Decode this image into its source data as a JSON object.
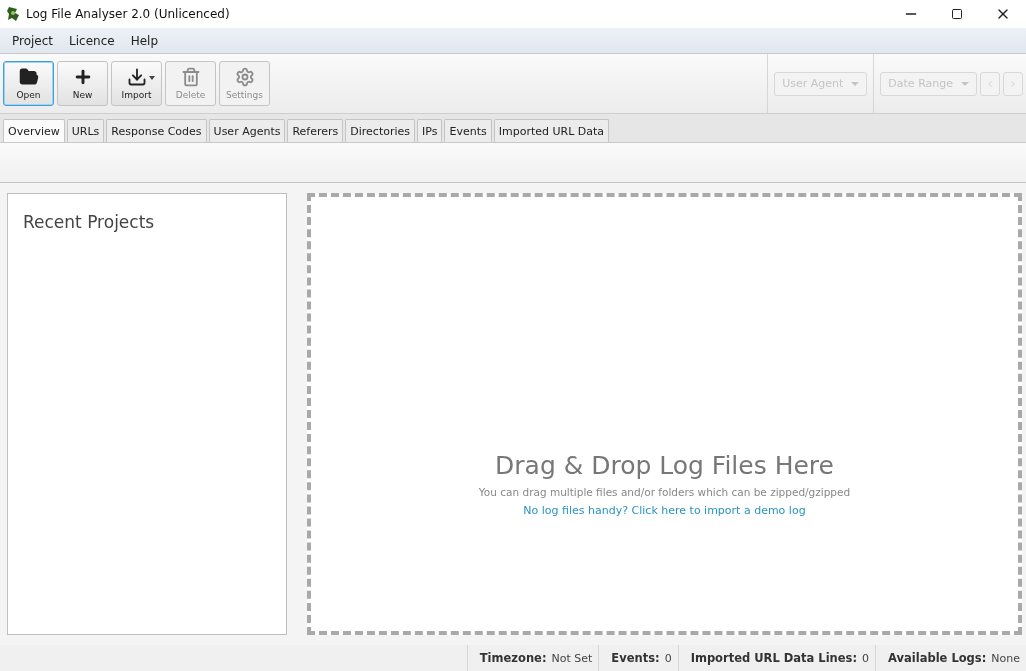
{
  "window": {
    "title": "Log File Analyser 2.0 (Unlicenced)"
  },
  "menu": [
    "Project",
    "Licence",
    "Help"
  ],
  "toolbar": [
    {
      "kind": "open",
      "label": "Open",
      "selected": true,
      "disabled": false,
      "dropdown": false
    },
    {
      "kind": "new",
      "label": "New",
      "selected": false,
      "disabled": false,
      "dropdown": false
    },
    {
      "kind": "import",
      "label": "Import",
      "selected": false,
      "disabled": false,
      "dropdown": true
    },
    {
      "kind": "delete",
      "label": "Delete",
      "selected": false,
      "disabled": true,
      "dropdown": false
    },
    {
      "kind": "settings",
      "label": "Settings",
      "selected": false,
      "disabled": true,
      "dropdown": false
    }
  ],
  "filters": {
    "user_agent": {
      "label": "User Agent",
      "disabled": true
    },
    "date_range": {
      "label": "Date Range",
      "disabled": true
    },
    "prev_disabled": true,
    "next_disabled": true
  },
  "tabs": [
    {
      "label": "Overview",
      "selected": true
    },
    {
      "label": "URLs",
      "selected": false
    },
    {
      "label": "Response Codes",
      "selected": false
    },
    {
      "label": "User Agents",
      "selected": false
    },
    {
      "label": "Referers",
      "selected": false
    },
    {
      "label": "Directories",
      "selected": false
    },
    {
      "label": "IPs",
      "selected": false
    },
    {
      "label": "Events",
      "selected": false
    },
    {
      "label": "Imported URL Data",
      "selected": false
    }
  ],
  "recent_projects": {
    "title": "Recent Projects"
  },
  "drop_zone": {
    "heading": "Drag & Drop Log Files Here",
    "hint": "You can drag multiple files and/or folders which can be zipped/gzipped",
    "link": "No log files handy? Click here to import a demo log"
  },
  "status_bar": [
    {
      "label": "Timezone:",
      "value": "Not Set"
    },
    {
      "label": "Events:",
      "value": "0"
    },
    {
      "label": "Imported URL Data Lines:",
      "value": "0"
    },
    {
      "label": "Available Logs:",
      "value": "None"
    }
  ]
}
